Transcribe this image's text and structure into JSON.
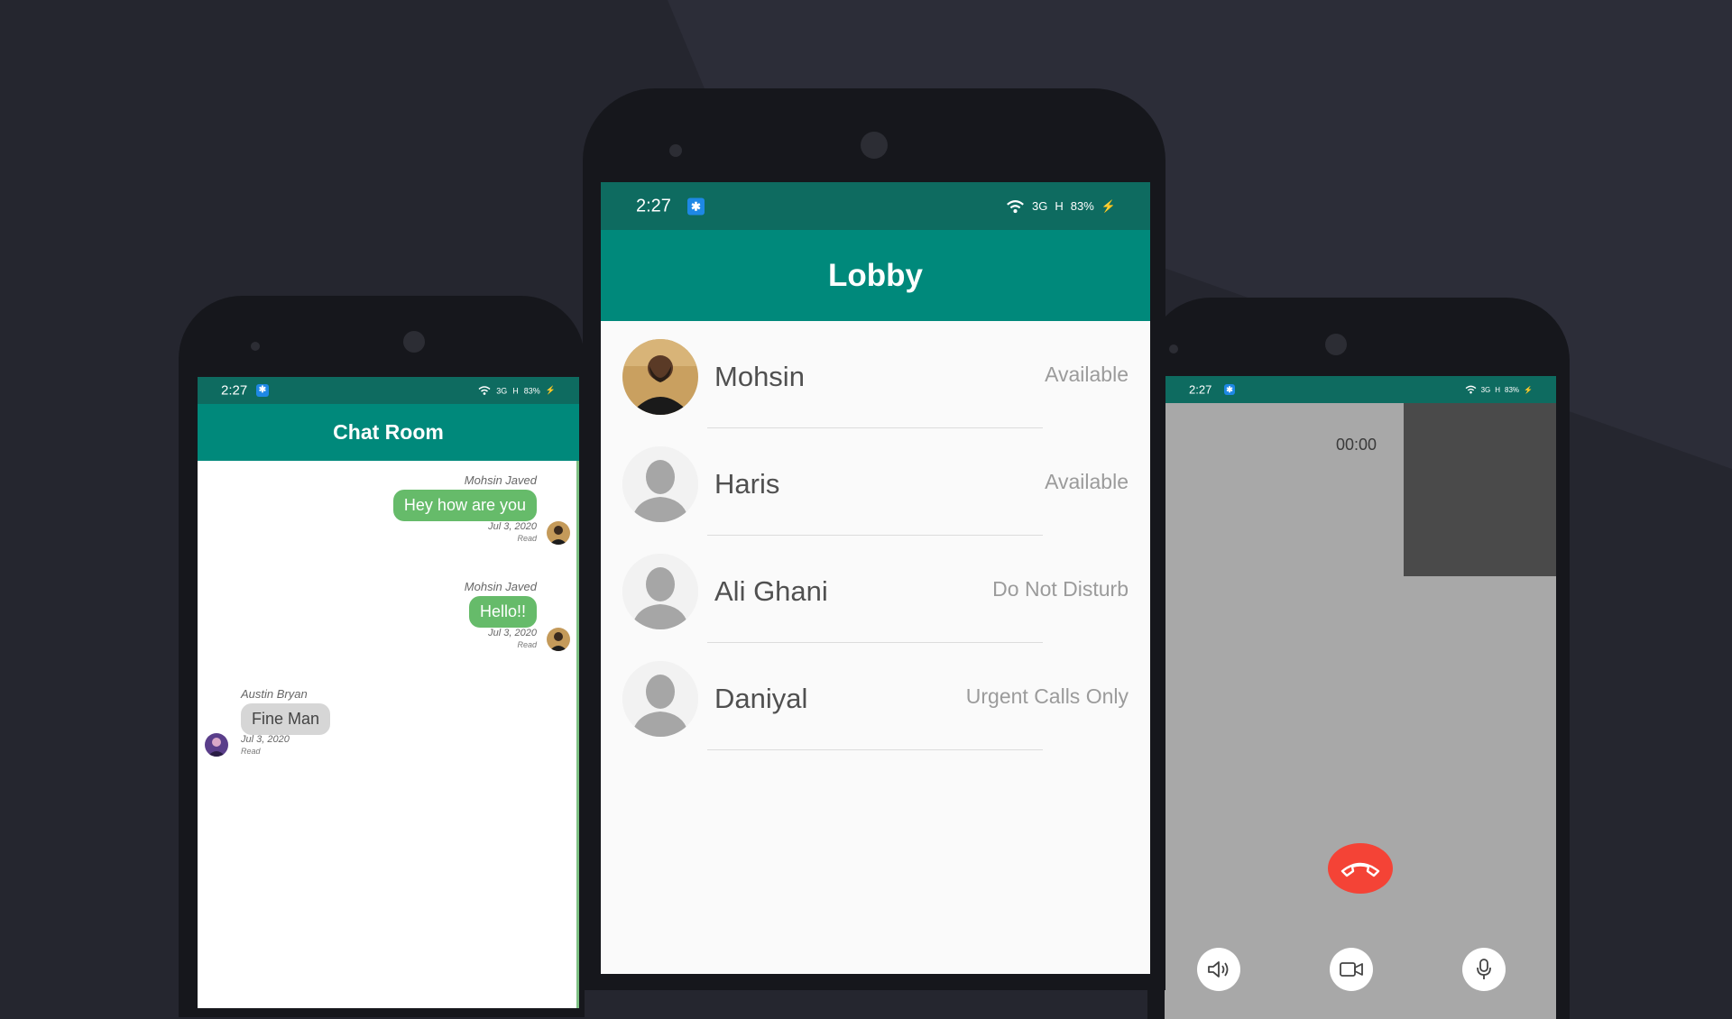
{
  "status_bar": {
    "time": "2:27",
    "bt_glyph": "✱",
    "net_3g": "3G",
    "net_h": "H",
    "battery": "83%"
  },
  "lobby": {
    "title": "Lobby",
    "contacts": [
      {
        "name": "Mohsin",
        "status": "Available",
        "avatar": "photo-avatar"
      },
      {
        "name": "Haris",
        "status": "Available",
        "avatar": "default-avatar"
      },
      {
        "name": "Ali Ghani",
        "status": "Do Not Disturb",
        "avatar": "default-avatar"
      },
      {
        "name": "Daniyal",
        "status": "Urgent Calls Only",
        "avatar": "default-avatar"
      }
    ]
  },
  "chat": {
    "title": "Chat Room",
    "messages": [
      {
        "author": "Mohsin Javed",
        "text": "Hey how are you",
        "date": "Jul 3, 2020",
        "receipt": "Read",
        "direction": "out"
      },
      {
        "author": "Mohsin Javed",
        "text": "Hello!!",
        "date": "Jul 3, 2020",
        "receipt": "Read",
        "direction": "out"
      },
      {
        "author": "Austin Bryan",
        "text": "Fine Man",
        "date": "Jul 3, 2020",
        "receipt": "Read",
        "direction": "in"
      }
    ]
  },
  "call": {
    "timer": "00:00",
    "end_icon": "phone-hangup-icon",
    "controls": [
      "speaker-icon",
      "video-icon",
      "microphone-icon"
    ]
  },
  "colors": {
    "background": "#25262f",
    "status_bar": "#0e6b60",
    "app_bar": "#00897b",
    "bubble_out": "#66bb6a",
    "bubble_in": "#d6d6d6",
    "end_call": "#f44336",
    "call_bg": "#a8a8a8",
    "preview_bg": "#4a4a4a"
  }
}
